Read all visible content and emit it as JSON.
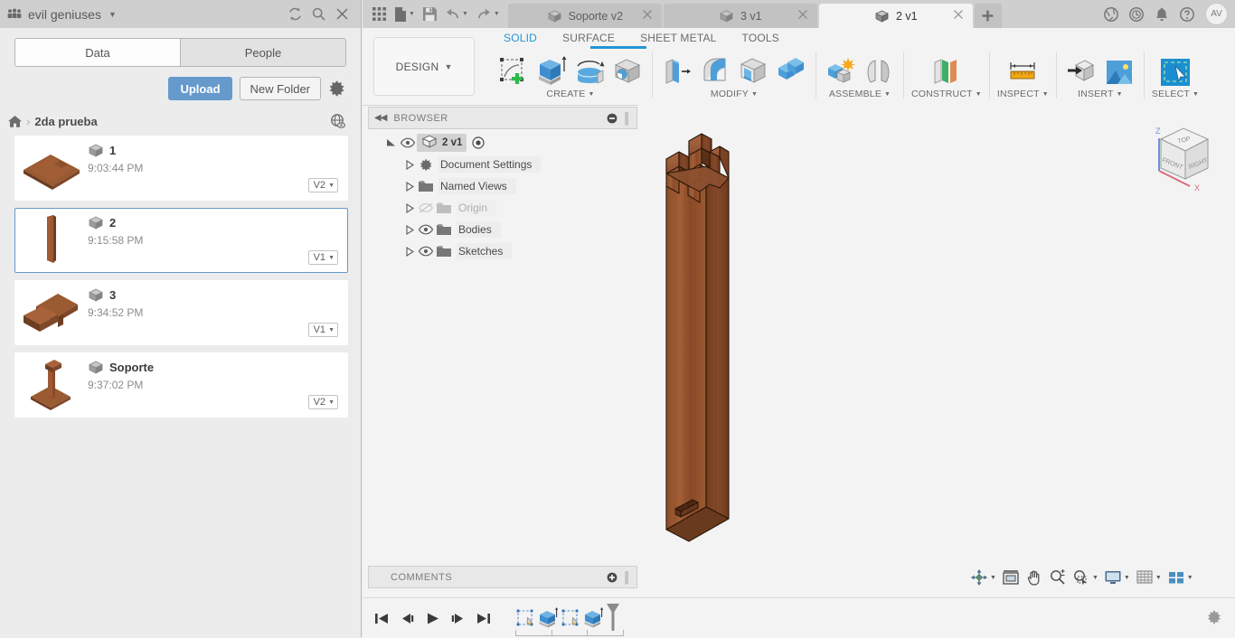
{
  "left_panel": {
    "hub_name": "evil geniuses",
    "hub_icon": "people-group-icon",
    "header_icons": [
      "refresh-icon",
      "search-icon",
      "close-icon"
    ],
    "tabs": [
      {
        "label": "Data",
        "active": true
      },
      {
        "label": "People",
        "active": false
      }
    ],
    "actions": {
      "upload_label": "Upload",
      "new_folder_label": "New Folder",
      "settings_icon": "gear-icon"
    },
    "breadcrumb": {
      "home_icon": "home-icon",
      "separator": "›",
      "current": "2da prueba",
      "globe_icon": "globe-eye-icon"
    },
    "files": [
      {
        "name": "1",
        "time": "9:03:44 PM",
        "version": "V2",
        "thumb": "flat-board",
        "selected": false
      },
      {
        "name": "2",
        "time": "9:15:58 PM",
        "version": "V1",
        "thumb": "tall-post",
        "selected": true
      },
      {
        "name": "3",
        "time": "9:34:52 PM",
        "version": "V1",
        "thumb": "stepped-block",
        "selected": false
      },
      {
        "name": "Soporte",
        "time": "9:37:02 PM",
        "version": "V2",
        "thumb": "stand",
        "selected": false
      }
    ]
  },
  "fusion": {
    "quick_access": [
      {
        "icon": "grid-apps-icon",
        "caret": false
      },
      {
        "icon": "new-file-icon",
        "caret": true
      },
      {
        "icon": "save-icon",
        "caret": false
      },
      {
        "icon": "undo-icon",
        "caret": true
      },
      {
        "icon": "redo-icon",
        "caret": true
      }
    ],
    "document_tabs": [
      {
        "label": "Soporte v2",
        "active": false,
        "closable": true
      },
      {
        "label": "3 v1",
        "active": false,
        "closable": true
      },
      {
        "label": "2 v1",
        "active": true,
        "closable": true
      }
    ],
    "new_tab_icon": "plus-icon",
    "tab_right_icons": [
      "job-status-globe-icon",
      "recent-clock-icon",
      "notifications-bell-icon",
      "help-question-icon"
    ],
    "avatar_initials": "AV",
    "ribbon": {
      "design_label": "DESIGN",
      "workspace_tabs": [
        {
          "label": "SOLID",
          "active": true
        },
        {
          "label": "SURFACE",
          "active": false
        },
        {
          "label": "SHEET METAL",
          "active": false
        },
        {
          "label": "TOOLS",
          "active": false
        }
      ],
      "groups": [
        {
          "label": "CREATE",
          "icons": [
            "create-sketch-icon",
            "extrude-icon",
            "revolve-icon",
            "hole-icon"
          ]
        },
        {
          "label": "MODIFY",
          "icons": [
            "press-pull-icon",
            "fillet-icon",
            "shell-icon",
            "combine-icon"
          ]
        },
        {
          "label": "ASSEMBLE",
          "icons": [
            "new-component-icon",
            "joint-icon"
          ]
        },
        {
          "label": "CONSTRUCT",
          "icons": [
            "offset-plane-icon"
          ]
        },
        {
          "label": "INSPECT",
          "icons": [
            "measure-ruler-icon"
          ]
        },
        {
          "label": "INSERT",
          "icons": [
            "insert-derive-icon",
            "insert-canvas-image-icon"
          ]
        },
        {
          "label": "SELECT",
          "icons": [
            "select-window-cursor-icon"
          ]
        }
      ]
    },
    "browser": {
      "title": "BROWSER",
      "collapse_icon": "double-chevron-left-icon",
      "minimize_icon": "minus-circle-icon",
      "root": {
        "label": "2 v1",
        "eye_icon": "eye-icon",
        "target_icon": "radio-target-icon",
        "cube_icon": "component-cube-icon"
      },
      "nodes": [
        {
          "label": "Document Settings",
          "icon": "gear-icon",
          "eye": "none"
        },
        {
          "label": "Named Views",
          "icon": "folder-icon",
          "eye": "none"
        },
        {
          "label": "Origin",
          "icon": "folder-icon",
          "eye": "hidden"
        },
        {
          "label": "Bodies",
          "icon": "folder-icon",
          "eye": "visible"
        },
        {
          "label": "Sketches",
          "icon": "folder-icon",
          "eye": "visible"
        }
      ]
    },
    "comments": {
      "title": "COMMENTS",
      "add_icon": "plus-circle-icon"
    },
    "viewcube": {
      "faces": {
        "top": "TOP",
        "front": "FRONT",
        "right": "RIGHT"
      },
      "axes": {
        "z": "Z",
        "x": "X"
      }
    },
    "navbar": [
      {
        "icon": "orbit-icon",
        "caret": true
      },
      {
        "icon": "look-at-icon",
        "caret": false
      },
      {
        "icon": "pan-hand-icon",
        "caret": false
      },
      {
        "icon": "zoom-magnifier-icon",
        "caret": false
      },
      {
        "icon": "zoom-window-icon",
        "caret": true
      },
      {
        "icon": "display-settings-icon",
        "caret": true
      },
      {
        "icon": "grid-snaps-icon",
        "caret": true
      },
      {
        "icon": "viewports-icon",
        "caret": true
      }
    ],
    "timeline": {
      "controls": [
        "skip-to-start-icon",
        "step-back-icon",
        "play-icon",
        "step-forward-icon",
        "skip-to-end-icon"
      ],
      "features": [
        "sketch-feature-icon",
        "extrude-feature-icon",
        "sketch-feature-icon",
        "extrude-feature-icon"
      ],
      "marker_icon": "timeline-marker-icon",
      "settings_icon": "gear-icon"
    },
    "model": {
      "name": "2 v1",
      "description": "wooden post with finger joints",
      "material_color": "#8a4b2a"
    }
  },
  "colors": {
    "accent_blue": "#2595d6",
    "upload_blue": "#6699cc",
    "panel_gray": "#ececec",
    "titlebar_gray": "#cfcfcf",
    "canvas_gray": "#f3f3f3",
    "wood_brown": "#8a4b2a"
  }
}
